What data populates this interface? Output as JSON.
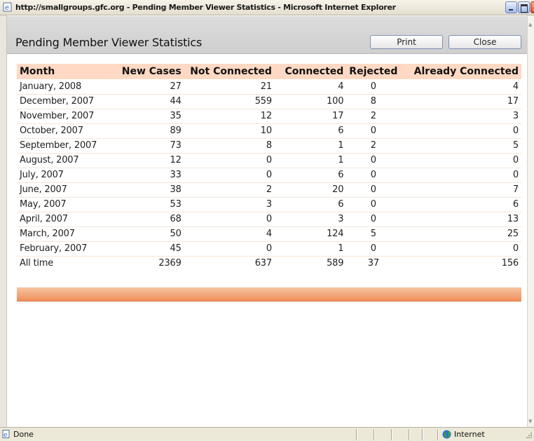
{
  "window": {
    "title": "http://smallgroups.gfc.org - Pending Member Viewer Statistics - Microsoft Internet Explorer"
  },
  "header": {
    "title": "Pending Member Viewer Statistics",
    "print_label": "Print",
    "close_label": "Close"
  },
  "table": {
    "columns": [
      "Month",
      "New Cases",
      "Not Connected",
      "Connected",
      "Rejected",
      "Already Connected"
    ],
    "rows": [
      {
        "month": "January, 2008",
        "new_cases": "27",
        "not_connected": "21",
        "connected": "4",
        "rejected": "0",
        "already_connected": "4"
      },
      {
        "month": "December, 2007",
        "new_cases": "44",
        "not_connected": "559",
        "connected": "100",
        "rejected": "8",
        "already_connected": "17"
      },
      {
        "month": "November, 2007",
        "new_cases": "35",
        "not_connected": "12",
        "connected": "17",
        "rejected": "2",
        "already_connected": "3"
      },
      {
        "month": "October, 2007",
        "new_cases": "89",
        "not_connected": "10",
        "connected": "6",
        "rejected": "0",
        "already_connected": "0"
      },
      {
        "month": "September, 2007",
        "new_cases": "73",
        "not_connected": "8",
        "connected": "1",
        "rejected": "2",
        "already_connected": "5"
      },
      {
        "month": "August, 2007",
        "new_cases": "12",
        "not_connected": "0",
        "connected": "1",
        "rejected": "0",
        "already_connected": "0"
      },
      {
        "month": "July, 2007",
        "new_cases": "33",
        "not_connected": "0",
        "connected": "6",
        "rejected": "0",
        "already_connected": "0"
      },
      {
        "month": "June, 2007",
        "new_cases": "38",
        "not_connected": "2",
        "connected": "20",
        "rejected": "0",
        "already_connected": "7"
      },
      {
        "month": "May, 2007",
        "new_cases": "53",
        "not_connected": "3",
        "connected": "6",
        "rejected": "0",
        "already_connected": "6"
      },
      {
        "month": "April, 2007",
        "new_cases": "68",
        "not_connected": "0",
        "connected": "3",
        "rejected": "0",
        "already_connected": "13"
      },
      {
        "month": "March, 2007",
        "new_cases": "50",
        "not_connected": "4",
        "connected": "124",
        "rejected": "5",
        "already_connected": "25"
      },
      {
        "month": "February, 2007",
        "new_cases": "45",
        "not_connected": "0",
        "connected": "1",
        "rejected": "0",
        "already_connected": "0"
      },
      {
        "month": "All time",
        "new_cases": "2369",
        "not_connected": "637",
        "connected": "589",
        "rejected": "37",
        "already_connected": "156"
      }
    ]
  },
  "statusbar": {
    "status": "Done",
    "zone": "Internet"
  },
  "colors": {
    "table_header": "#ffd9c4",
    "footer_bar": "#ef8f5a",
    "header_panel": "#d4d4d4"
  },
  "icons": [
    "ie-page-icon",
    "minimize-icon",
    "maximize-icon",
    "close-icon",
    "document-icon",
    "globe-icon",
    "resize-grip-icon"
  ]
}
